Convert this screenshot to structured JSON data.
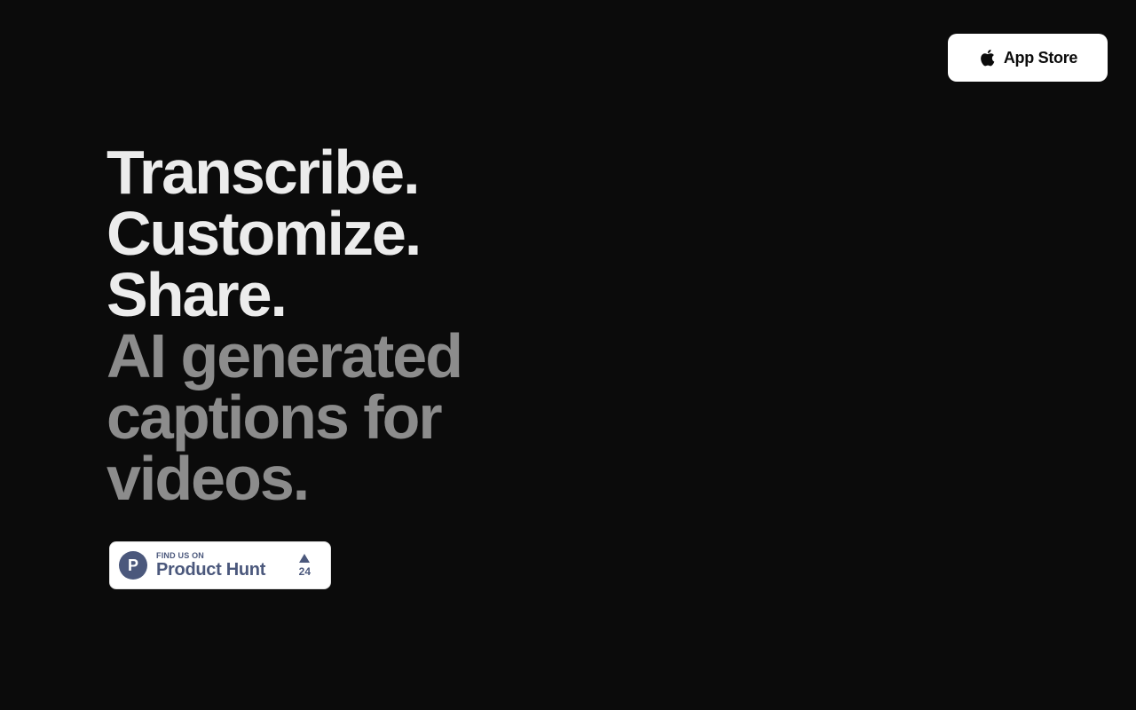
{
  "header": {
    "appstore_label": "App Store",
    "appstore_icon": "apple-icon"
  },
  "hero": {
    "lines": [
      "Transcribe.",
      "Customize.",
      "Share.",
      "AI generated",
      "captions for",
      "videos."
    ]
  },
  "product_hunt": {
    "small_text": "FIND US ON",
    "big_text": "Product Hunt",
    "logo_letter": "P",
    "upvote_icon": "upvote-arrow-icon",
    "votes": "24"
  },
  "colors": {
    "background": "#0b0b0b",
    "primary_text": "#ececec",
    "secondary_text": "#8c8c8c",
    "product_hunt_brand": "#4b587c"
  }
}
